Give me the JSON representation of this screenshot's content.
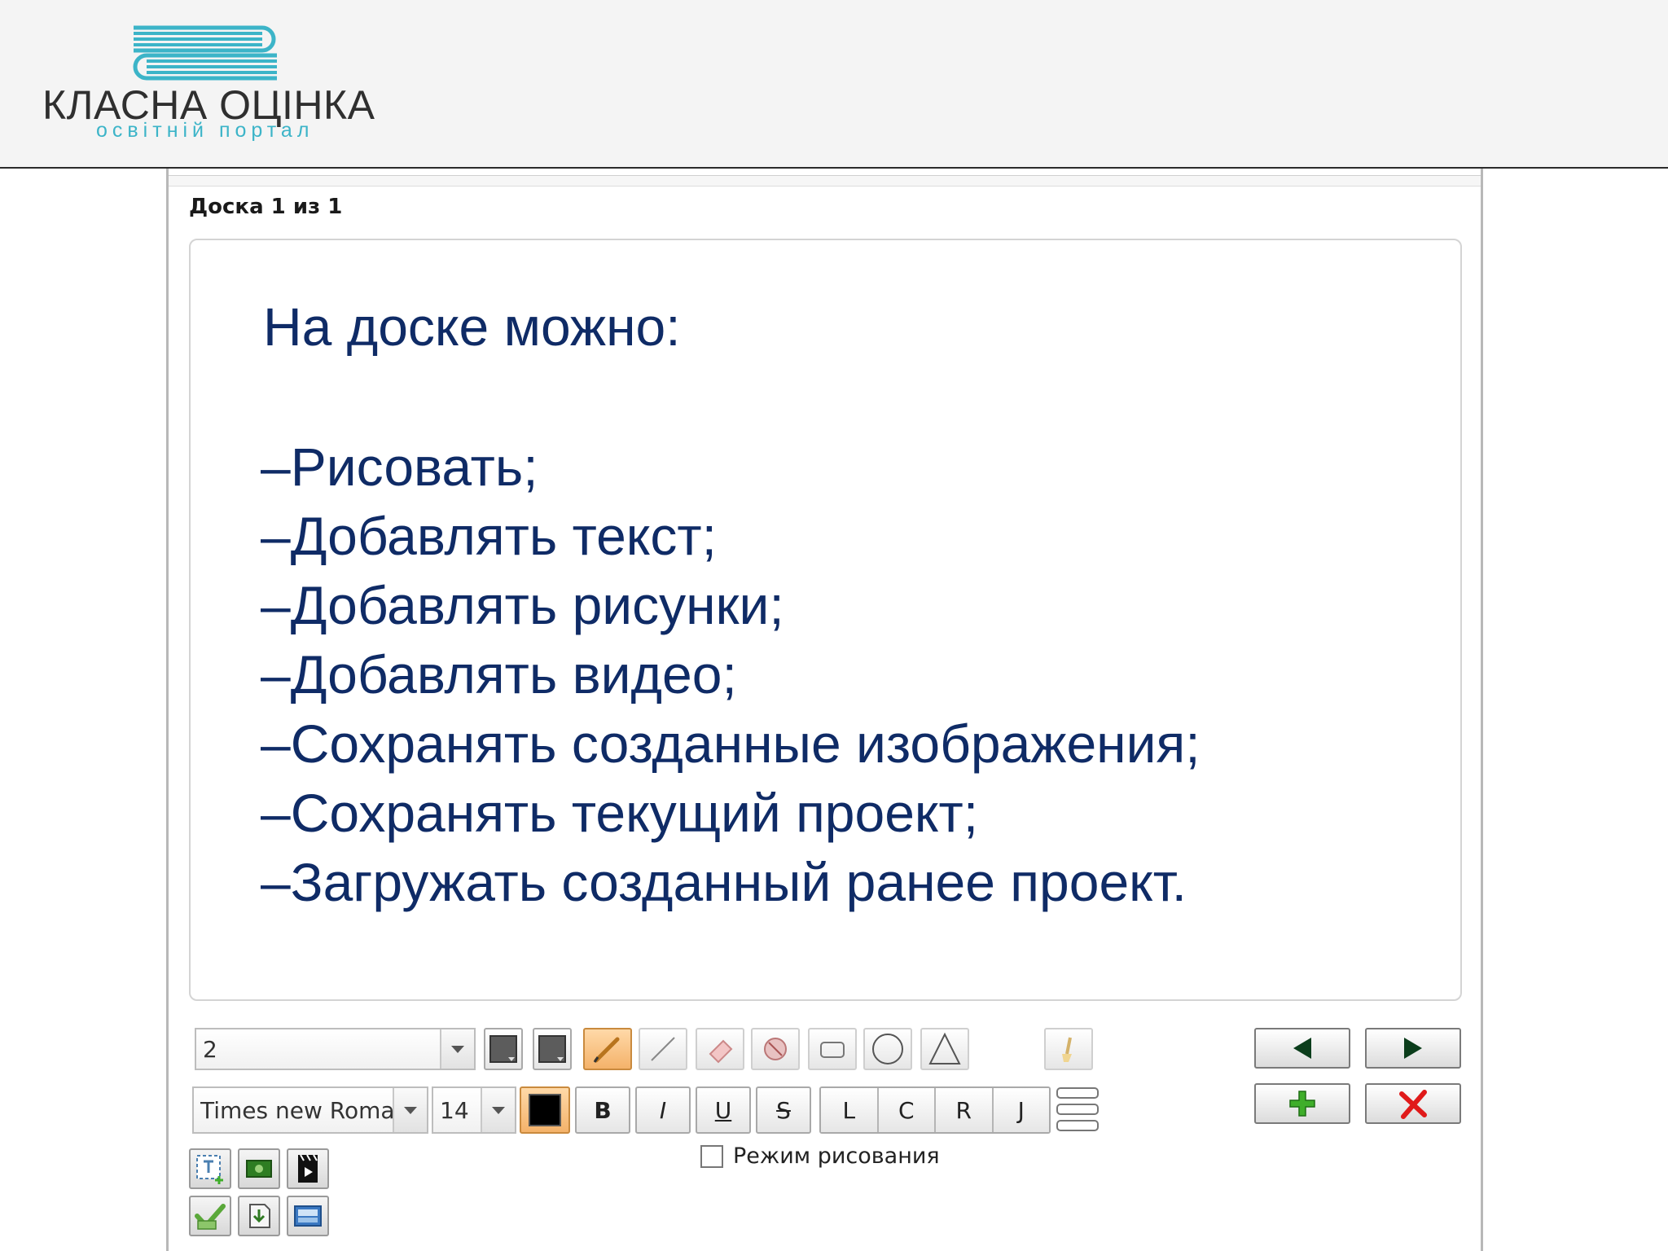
{
  "header": {
    "logo_title": "КЛАСНА ОЦІНКА",
    "logo_subtitle": "освітній портал",
    "logo_color": "#3cb4c8"
  },
  "board": {
    "counter": "Доска 1 из 1",
    "heading": "На доске можно:",
    "items": [
      "–Рисовать;",
      "–Добавлять текст;",
      "–Добавлять рисунки;",
      "–Добавлять видео;",
      "–Сохранять созданные изображения;",
      "–Сохранять текущий проект;",
      "–Загружать созданный ранее проект."
    ],
    "text_color": "#0f2b66"
  },
  "toolbar": {
    "line_width_value": "2",
    "font_family_value": "Times new Roman",
    "font_size_value": "14",
    "bold_label": "B",
    "italic_label": "I",
    "underline_label": "U",
    "strike_label": "S",
    "align_left_label": "L",
    "align_center_label": "C",
    "align_right_label": "R",
    "align_justify_label": "J",
    "drawing_mode_label": "Режим рисования",
    "drawing_mode_checked": false,
    "tools": [
      "fill-color-icon",
      "stroke-color-icon",
      "pencil-icon",
      "line-icon",
      "eraser-icon",
      "clear-icon",
      "rectangle-icon",
      "circle-icon",
      "triangle-icon",
      "brush-icon"
    ],
    "nav": [
      "previous-board-icon",
      "next-board-icon",
      "add-board-icon",
      "delete-board-icon"
    ],
    "insert": [
      "add-text-icon",
      "add-image-icon",
      "add-video-icon",
      "save-image-icon",
      "save-project-icon",
      "load-project-icon"
    ]
  }
}
